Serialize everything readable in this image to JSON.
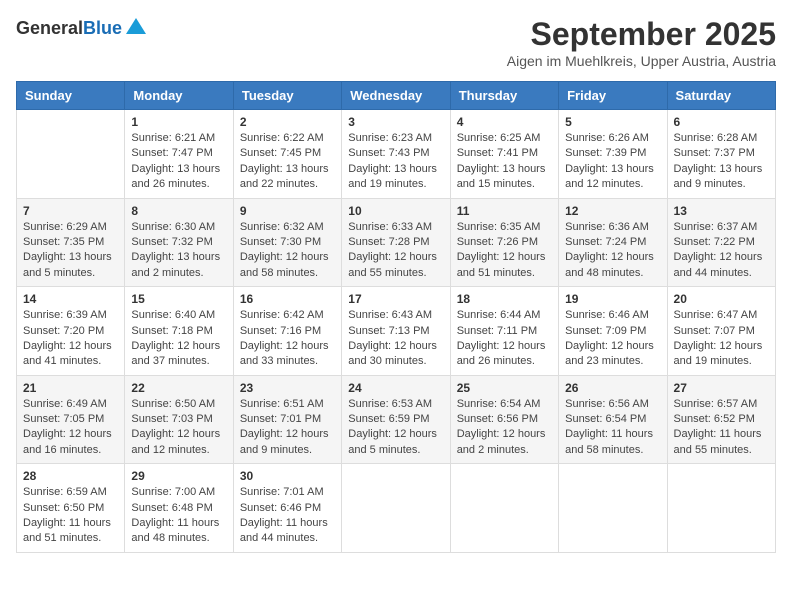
{
  "header": {
    "logo": {
      "text_general": "General",
      "text_blue": "Blue",
      "icon": "▲"
    },
    "title": "September 2025",
    "location": "Aigen im Muehlkreis, Upper Austria, Austria"
  },
  "calendar": {
    "weekdays": [
      "Sunday",
      "Monday",
      "Tuesday",
      "Wednesday",
      "Thursday",
      "Friday",
      "Saturday"
    ],
    "weeks": [
      {
        "days": [
          {
            "num": "",
            "info": ""
          },
          {
            "num": "1",
            "info": "Sunrise: 6:21 AM\nSunset: 7:47 PM\nDaylight: 13 hours\nand 26 minutes."
          },
          {
            "num": "2",
            "info": "Sunrise: 6:22 AM\nSunset: 7:45 PM\nDaylight: 13 hours\nand 22 minutes."
          },
          {
            "num": "3",
            "info": "Sunrise: 6:23 AM\nSunset: 7:43 PM\nDaylight: 13 hours\nand 19 minutes."
          },
          {
            "num": "4",
            "info": "Sunrise: 6:25 AM\nSunset: 7:41 PM\nDaylight: 13 hours\nand 15 minutes."
          },
          {
            "num": "5",
            "info": "Sunrise: 6:26 AM\nSunset: 7:39 PM\nDaylight: 13 hours\nand 12 minutes."
          },
          {
            "num": "6",
            "info": "Sunrise: 6:28 AM\nSunset: 7:37 PM\nDaylight: 13 hours\nand 9 minutes."
          }
        ]
      },
      {
        "days": [
          {
            "num": "7",
            "info": "Sunrise: 6:29 AM\nSunset: 7:35 PM\nDaylight: 13 hours\nand 5 minutes."
          },
          {
            "num": "8",
            "info": "Sunrise: 6:30 AM\nSunset: 7:32 PM\nDaylight: 13 hours\nand 2 minutes."
          },
          {
            "num": "9",
            "info": "Sunrise: 6:32 AM\nSunset: 7:30 PM\nDaylight: 12 hours\nand 58 minutes."
          },
          {
            "num": "10",
            "info": "Sunrise: 6:33 AM\nSunset: 7:28 PM\nDaylight: 12 hours\nand 55 minutes."
          },
          {
            "num": "11",
            "info": "Sunrise: 6:35 AM\nSunset: 7:26 PM\nDaylight: 12 hours\nand 51 minutes."
          },
          {
            "num": "12",
            "info": "Sunrise: 6:36 AM\nSunset: 7:24 PM\nDaylight: 12 hours\nand 48 minutes."
          },
          {
            "num": "13",
            "info": "Sunrise: 6:37 AM\nSunset: 7:22 PM\nDaylight: 12 hours\nand 44 minutes."
          }
        ]
      },
      {
        "days": [
          {
            "num": "14",
            "info": "Sunrise: 6:39 AM\nSunset: 7:20 PM\nDaylight: 12 hours\nand 41 minutes."
          },
          {
            "num": "15",
            "info": "Sunrise: 6:40 AM\nSunset: 7:18 PM\nDaylight: 12 hours\nand 37 minutes."
          },
          {
            "num": "16",
            "info": "Sunrise: 6:42 AM\nSunset: 7:16 PM\nDaylight: 12 hours\nand 33 minutes."
          },
          {
            "num": "17",
            "info": "Sunrise: 6:43 AM\nSunset: 7:13 PM\nDaylight: 12 hours\nand 30 minutes."
          },
          {
            "num": "18",
            "info": "Sunrise: 6:44 AM\nSunset: 7:11 PM\nDaylight: 12 hours\nand 26 minutes."
          },
          {
            "num": "19",
            "info": "Sunrise: 6:46 AM\nSunset: 7:09 PM\nDaylight: 12 hours\nand 23 minutes."
          },
          {
            "num": "20",
            "info": "Sunrise: 6:47 AM\nSunset: 7:07 PM\nDaylight: 12 hours\nand 19 minutes."
          }
        ]
      },
      {
        "days": [
          {
            "num": "21",
            "info": "Sunrise: 6:49 AM\nSunset: 7:05 PM\nDaylight: 12 hours\nand 16 minutes."
          },
          {
            "num": "22",
            "info": "Sunrise: 6:50 AM\nSunset: 7:03 PM\nDaylight: 12 hours\nand 12 minutes."
          },
          {
            "num": "23",
            "info": "Sunrise: 6:51 AM\nSunset: 7:01 PM\nDaylight: 12 hours\nand 9 minutes."
          },
          {
            "num": "24",
            "info": "Sunrise: 6:53 AM\nSunset: 6:59 PM\nDaylight: 12 hours\nand 5 minutes."
          },
          {
            "num": "25",
            "info": "Sunrise: 6:54 AM\nSunset: 6:56 PM\nDaylight: 12 hours\nand 2 minutes."
          },
          {
            "num": "26",
            "info": "Sunrise: 6:56 AM\nSunset: 6:54 PM\nDaylight: 11 hours\nand 58 minutes."
          },
          {
            "num": "27",
            "info": "Sunrise: 6:57 AM\nSunset: 6:52 PM\nDaylight: 11 hours\nand 55 minutes."
          }
        ]
      },
      {
        "days": [
          {
            "num": "28",
            "info": "Sunrise: 6:59 AM\nSunset: 6:50 PM\nDaylight: 11 hours\nand 51 minutes."
          },
          {
            "num": "29",
            "info": "Sunrise: 7:00 AM\nSunset: 6:48 PM\nDaylight: 11 hours\nand 48 minutes."
          },
          {
            "num": "30",
            "info": "Sunrise: 7:01 AM\nSunset: 6:46 PM\nDaylight: 11 hours\nand 44 minutes."
          },
          {
            "num": "",
            "info": ""
          },
          {
            "num": "",
            "info": ""
          },
          {
            "num": "",
            "info": ""
          },
          {
            "num": "",
            "info": ""
          }
        ]
      }
    ]
  }
}
